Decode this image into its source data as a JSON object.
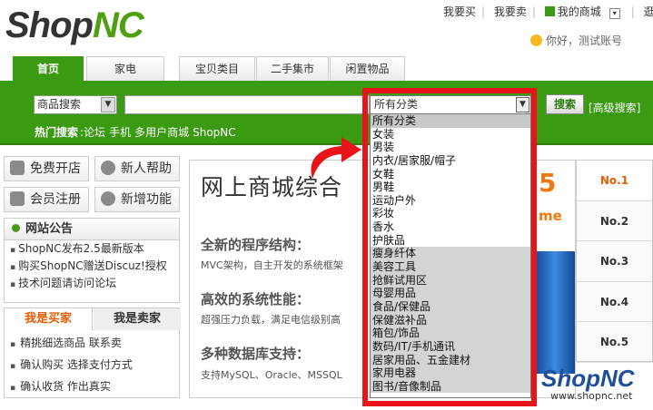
{
  "logo": {
    "part1": "Shop",
    "part2": "NC"
  },
  "top_links": [
    "我要买",
    "我要卖",
    "我的商城",
    "逛街"
  ],
  "hello": "你好，测试账号",
  "tabs": [
    "首页",
    "家电",
    "宝贝类目",
    "二手集市",
    "闲置物品"
  ],
  "search": {
    "type_select": "商品搜索",
    "category_select": "所有分类",
    "button": "搜索",
    "advanced": "[高级搜索]",
    "hot_label": "热门搜索",
    "hot_items": [
      ":论坛",
      "手机",
      "多用户商城",
      "ShopNC"
    ]
  },
  "side_buttons": {
    "open_shop": "免费开店",
    "help": "新人帮助",
    "register": "会员注册",
    "new_features": "新增功能"
  },
  "notice": {
    "title": "网站公告",
    "items": [
      "ShopNC发布2.5最新版本",
      "购买ShopNC赠送Discuz!授权",
      "技术问题请访问论坛"
    ]
  },
  "buyer_tabs": {
    "buyer": "我是买家",
    "seller": "我是卖家"
  },
  "buyer_items": [
    "精挑细选商品 联系卖",
    "确认购买 选择支付方式",
    "确认收货 作出真实"
  ],
  "banner": {
    "title": "网上商城综合",
    "h1": "全新的程序结构：",
    "d1": "MVC架构，自主开发的系统框架",
    "h2": "高效的系统性能：",
    "d2": "超强压力负载，满足电信级别高",
    "h3": "多种数据库支持：",
    "d3": "支持MySQL、Oracle、MSSQL",
    "big5": "5",
    "me": "me"
  },
  "ranks": [
    "No.1",
    "No.2",
    "No.3",
    "No.4",
    "No.5"
  ],
  "watermark": {
    "brand": "ShopNC",
    "url": "www.shopnc.net"
  },
  "dropdown_options": [
    "所有分类",
    "女装",
    "男装",
    "内衣/居家服/帽子",
    "女鞋",
    "男鞋",
    "运动户外",
    "彩妆",
    "香水",
    "护肤品",
    "瘦身纤体",
    "美容工具",
    "抢鲜试用区",
    "母婴用品",
    "食品/保健品",
    "保健滋补品",
    "箱包/饰品",
    "数码/IT/手机通讯",
    "居家用品、五金建材",
    "家用电器",
    "图书/音像制品"
  ],
  "colors": {
    "green": "#3a9a12",
    "highlight": "#e8141a",
    "orange": "#e65c00"
  }
}
